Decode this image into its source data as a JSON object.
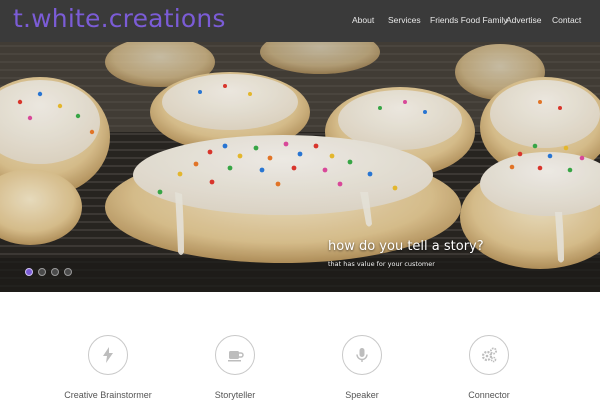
{
  "brand": {
    "logo_text": "t.white.creations",
    "accent_color": "#7b5cd6"
  },
  "nav": {
    "items": [
      {
        "label": "About"
      },
      {
        "label": "Services"
      },
      {
        "label": "Friends Food Family"
      },
      {
        "label": "Advertise"
      },
      {
        "label": "Contact"
      }
    ]
  },
  "hero": {
    "caption_title": "how do you tell a story?",
    "caption_subtitle": "that has value for your customer",
    "slide_count": 4,
    "active_slide": 1
  },
  "features": [
    {
      "label": "Creative Brainstormer",
      "icon": "lightning-icon"
    },
    {
      "label": "Storyteller",
      "icon": "coffee-cup-icon"
    },
    {
      "label": "Speaker",
      "icon": "microphone-icon"
    },
    {
      "label": "Connector",
      "icon": "gears-icon"
    }
  ]
}
